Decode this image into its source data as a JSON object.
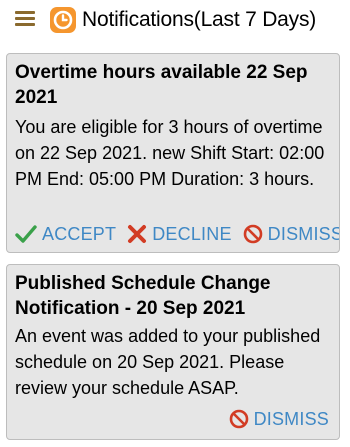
{
  "header": {
    "title": "Notifications(Last 7 Days)"
  },
  "colors": {
    "accent_blue": "#3f88c5",
    "accept_green": "#3aa14a",
    "decline_red": "#d23c24",
    "dismiss_red": "#d23c24",
    "logo_orange": "#f5962e",
    "card_bg": "#e6e6e6"
  },
  "notifications": [
    {
      "title": "Overtime hours available 22 Sep 2021",
      "body": "You are eligible for 3 hours of overtime on 22 Sep 2021.  new Shift Start: 02:00 PM End: 05:00 PM Duration: 3 hours.",
      "actions": [
        {
          "label": "ACCEPT",
          "icon": "check-icon"
        },
        {
          "label": "DECLINE",
          "icon": "x-icon"
        },
        {
          "label": "DISMISS",
          "icon": "prohibited-icon"
        }
      ]
    },
    {
      "title": "Published Schedule Change Notification - 20 Sep 2021",
      "body": "An event was added to your published schedule on 20 Sep 2021. Please review your schedule ASAP.",
      "actions": [
        {
          "label": "DISMISS",
          "icon": "prohibited-icon"
        }
      ]
    }
  ]
}
